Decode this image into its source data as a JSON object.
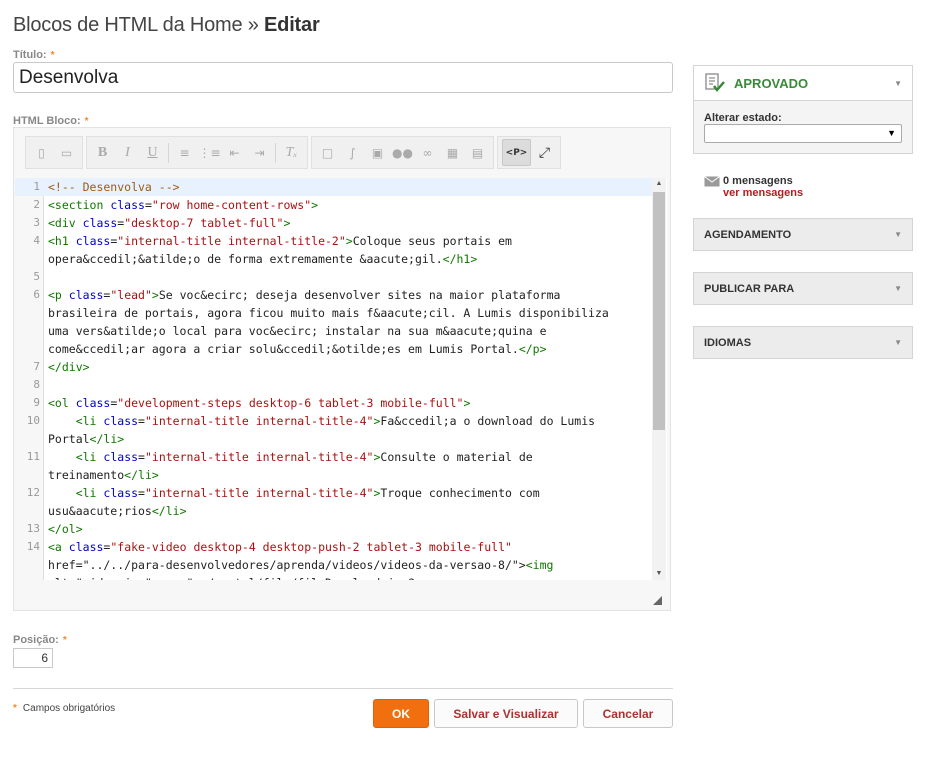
{
  "header": {
    "title_main": "Blocos de HTML da Home » ",
    "title_action": "Editar"
  },
  "form": {
    "title_label": "Título:",
    "title_value": "Desenvolva",
    "html_label": "HTML Bloco:",
    "position_label": "Posição:",
    "position_value": "6",
    "required_star": "*",
    "required_note": "Campos obrigatórios"
  },
  "toolbar": {
    "groups": [
      [
        "template-icon",
        "document-icon"
      ],
      [
        "bold-icon",
        "italic-icon",
        "underline-icon",
        "ordered-list-icon",
        "unordered-list-icon",
        "outdent-icon",
        "indent-icon",
        "clear-format-icon"
      ],
      [
        "new-page-icon",
        "attach-icon",
        "image-icon",
        "find-icon",
        "link-icon",
        "table-icon",
        "preview-icon"
      ],
      [
        "source-view-icon",
        "fullscreen-icon"
      ]
    ],
    "source_label": "<P>"
  },
  "code": {
    "lines": [
      {
        "n": "1",
        "t": "<!-- Desenvolva -->"
      },
      {
        "n": "2",
        "t": "<section class=\"row home-content-rows\">"
      },
      {
        "n": "3",
        "t": "<div class=\"desktop-7 tablet-full\">"
      },
      {
        "n": "4",
        "t": "<h1 class=\"internal-title internal-title-2\">Coloque seus portais em"
      },
      {
        "n": "",
        "t": "opera&ccedil;&atilde;o de forma extremamente &aacute;gil.</h1>"
      },
      {
        "n": "5",
        "t": ""
      },
      {
        "n": "6",
        "t": "<p class=\"lead\">Se voc&ecirc; deseja desenvolver sites na maior plataforma"
      },
      {
        "n": "",
        "t": "brasileira de portais, agora ficou muito mais f&aacute;cil. A Lumis disponibiliza"
      },
      {
        "n": "",
        "t": "uma vers&atilde;o local para voc&ecirc; instalar na sua m&aacute;quina e"
      },
      {
        "n": "",
        "t": "come&ccedil;ar agora a criar solu&ccedil;&otilde;es em Lumis Portal.</p>"
      },
      {
        "n": "7",
        "t": "</div>"
      },
      {
        "n": "8",
        "t": ""
      },
      {
        "n": "9",
        "t": "<ol class=\"development-steps desktop-6 tablet-3 mobile-full\">"
      },
      {
        "n": "10",
        "t": "    <li class=\"internal-title internal-title-4\">Fa&ccedil;a o download do Lumis"
      },
      {
        "n": "",
        "t": "Portal</li>"
      },
      {
        "n": "11",
        "t": "    <li class=\"internal-title internal-title-4\">Consulte o material de"
      },
      {
        "n": "",
        "t": "treinamento</li>"
      },
      {
        "n": "12",
        "t": "    <li class=\"internal-title internal-title-4\">Troque conhecimento com"
      },
      {
        "n": "",
        "t": "usu&aacute;rios</li>"
      },
      {
        "n": "13",
        "t": "</ol>"
      },
      {
        "n": "14",
        "t": "<a class=\"fake-video desktop-4 desktop-push-2 tablet-3 mobile-full\""
      },
      {
        "n": "",
        "t": "href=\"../../para-desenvolvedores/aprenda/videos/videos-da-versao-8/\"><img"
      },
      {
        "n": "",
        "t": "alt=\"video.jpg\" src=\"../portal/file/fileDownload.jsp?"
      }
    ]
  },
  "buttons": {
    "ok": "OK",
    "save_view": "Salvar e Visualizar",
    "cancel": "Cancelar"
  },
  "sidebar": {
    "status": "APROVADO",
    "change_status_label": "Alterar estado:",
    "messages_count": "0 mensagens",
    "messages_link": "ver mensagens",
    "sections": [
      "AGENDAMENTO",
      "PUBLICAR PARA",
      "IDIOMAS"
    ]
  },
  "colors": {
    "accent": "#f26f10",
    "approved": "#3a8a3a",
    "link": "#b02020"
  }
}
